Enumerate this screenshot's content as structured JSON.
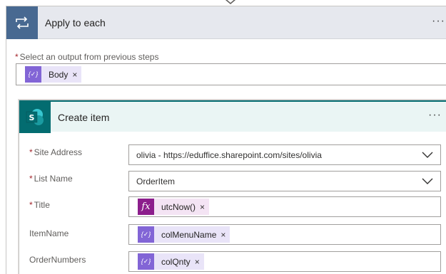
{
  "loop": {
    "title": "Apply to each",
    "more_label": "···",
    "output_label": "Select an output from previous steps",
    "token": {
      "label": "Body",
      "remove": "×"
    }
  },
  "create": {
    "title": "Create item",
    "more_label": "···",
    "sp_letter": "S",
    "fields": {
      "site": {
        "label": "Site Address",
        "value": "olivia - https://eduffice.sharepoint.com/sites/olivia"
      },
      "list": {
        "label": "List Name",
        "value": "OrderItem"
      },
      "title": {
        "label": "Title",
        "token": "utcNow()",
        "remove": "×"
      },
      "itemname": {
        "label": "ItemName",
        "token": "colMenuName",
        "remove": "×"
      },
      "ordernumbers": {
        "label": "OrderNumbers",
        "token": "colQnty",
        "remove": "×"
      }
    }
  },
  "required_mark": "*",
  "dynamic_icon": "{✓}",
  "fx_icon": "fx",
  "colors": {
    "loop_accent": "#486991",
    "sharepoint_accent": "#036c70",
    "dynamic_token": "#8265d6",
    "expression_token": "#8c1e8c"
  }
}
